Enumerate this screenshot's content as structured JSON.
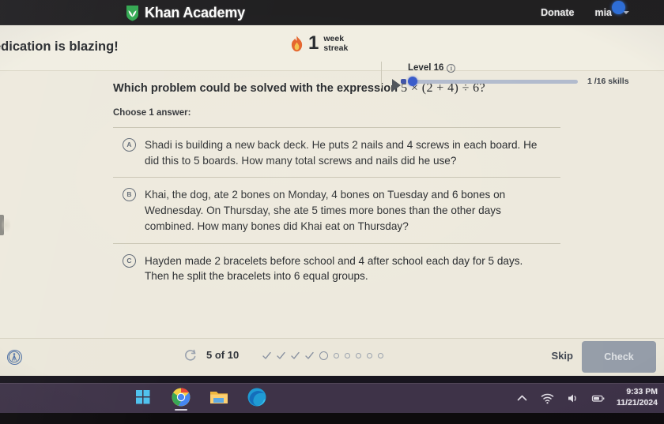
{
  "nav": {
    "logo_text": "Khan Academy",
    "logo_icon": "khan-leaf-logo",
    "donate_label": "Donate",
    "user_name": "mia",
    "avatar_icon": "user-avatar",
    "chevron_icon": "chevron-down-icon"
  },
  "streak": {
    "headline": "edication is blazing!",
    "flame_icon": "flame-icon",
    "count": "1",
    "unit_line1": "week",
    "unit_line2": "streak",
    "play_icon": "play-triangle-icon",
    "level_label": "Level 16",
    "info_icon": "info-icon",
    "info_glyph": "i",
    "skills_progress": "1 /16 skills",
    "progress_value": 1,
    "progress_total": 16
  },
  "exercise": {
    "question_prefix": "Which problem could be solved with the expression ",
    "question_expression": "5 × (2 + 4) ÷ 6?",
    "choose_label": "Choose 1 answer:",
    "choices": [
      {
        "letter": "A",
        "text": "Shadi is building a new back deck. He puts 2 nails and 4 screws in each board. He did this to 5 boards. How many total screws and nails did he use?"
      },
      {
        "letter": "B",
        "text": "Khai, the dog, ate 2 bones on Monday, 4 bones on Tuesday and 6 bones on Wednesday. On Thursday, she ate 5 times more bones than the other days combined. How many bones did Khai eat on Thursday?"
      },
      {
        "letter": "C",
        "text": "Hayden made 2 bracelets before school and 4 after school each day for 5 days. Then he split the bracelets into 6 equal groups."
      }
    ]
  },
  "footer": {
    "accessibility_icon": "accessibility-icon",
    "refresh_icon": "refresh-icon",
    "counter": "5 of 10",
    "progress_dots": [
      "check",
      "check",
      "check",
      "check",
      "current",
      "empty",
      "empty",
      "empty",
      "empty",
      "empty"
    ],
    "skip_label": "Skip",
    "check_label": "Check"
  },
  "taskbar": {
    "apps": [
      {
        "name": "start-button",
        "icon": "windows-logo-icon",
        "active": false
      },
      {
        "name": "chrome-app",
        "icon": "chrome-icon",
        "active": true
      },
      {
        "name": "file-explorer-app",
        "icon": "folder-icon",
        "active": false
      },
      {
        "name": "edge-app",
        "icon": "edge-icon",
        "active": false
      }
    ],
    "tray": [
      {
        "name": "show-hidden-icons",
        "icon": "chevron-up-icon"
      },
      {
        "name": "network-status",
        "icon": "wifi-icon"
      },
      {
        "name": "volume-control",
        "icon": "speaker-icon"
      },
      {
        "name": "battery-status",
        "icon": "battery-icon"
      }
    ],
    "time": "9:33 PM",
    "date": "11/21/2024"
  },
  "colors": {
    "nav_bg": "#1c1b1e",
    "page_bg": "#f0ece0",
    "accent_blue": "#3257cd",
    "flame_orange": "#e8632a",
    "taskbar_bg": "#3b2f46",
    "check_button": "#8e97a6"
  }
}
